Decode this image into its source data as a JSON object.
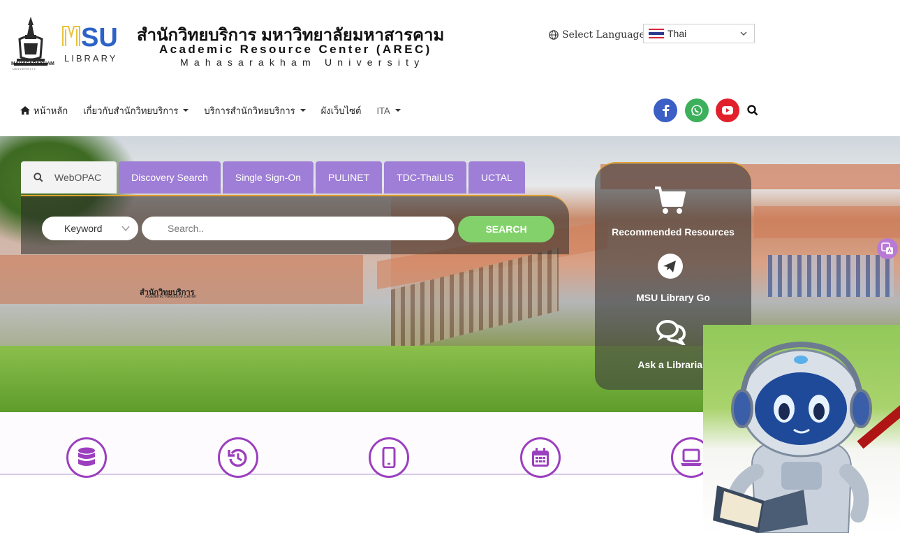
{
  "header": {
    "seal_text": "MAHASARAKHAM",
    "seal_sub": "UNIVERSITY",
    "logo_text": "MSU",
    "logo_sub": "LIBRARY",
    "title_th": "สำนักวิทยบริการ มหาวิทยาลัยมหาสารคาม",
    "title_en": "Academic Resource Center (AREC)",
    "title_uni": "Mahasarakham University",
    "language_label": "Select Language",
    "language_value": "Thai"
  },
  "nav": {
    "items": [
      {
        "label": "หน้าหลัก"
      },
      {
        "label": "เกี่ยวกับสำนักวิทยบริการ"
      },
      {
        "label": "บริการสำนักวิทยบริการ"
      },
      {
        "label": "ผังเว็บไซต์"
      },
      {
        "label": "ITA"
      }
    ],
    "social": [
      "facebook-icon",
      "whatsapp-icon",
      "youtube-icon"
    ],
    "colors": {
      "facebook": "#3b5fc5",
      "whatsapp": "#3cb05a",
      "youtube": "#e2202c"
    }
  },
  "hero": {
    "sign": "สำนักวิทยบริการ",
    "sign_en": "Academic Resource Center"
  },
  "search": {
    "tabs": [
      {
        "label": "WebOPAC"
      },
      {
        "label": "Discovery Search"
      },
      {
        "label": "Single Sign-On"
      },
      {
        "label": "PULINET"
      },
      {
        "label": "TDC-ThaiLIS"
      },
      {
        "label": "UCTAL"
      }
    ],
    "field_selected": "Keyword",
    "placeholder": "Search..",
    "button_label": "SEARCH",
    "accent": "#9e7ed6",
    "button_color": "#82d16a"
  },
  "quick_links": [
    {
      "label": "Recommended Resources"
    },
    {
      "label": "MSU Library Go"
    },
    {
      "label": "Ask a Librarian"
    }
  ],
  "features": [
    "database-icon",
    "history-icon",
    "mobile-icon",
    "calendar-icon",
    "laptop-icon"
  ]
}
